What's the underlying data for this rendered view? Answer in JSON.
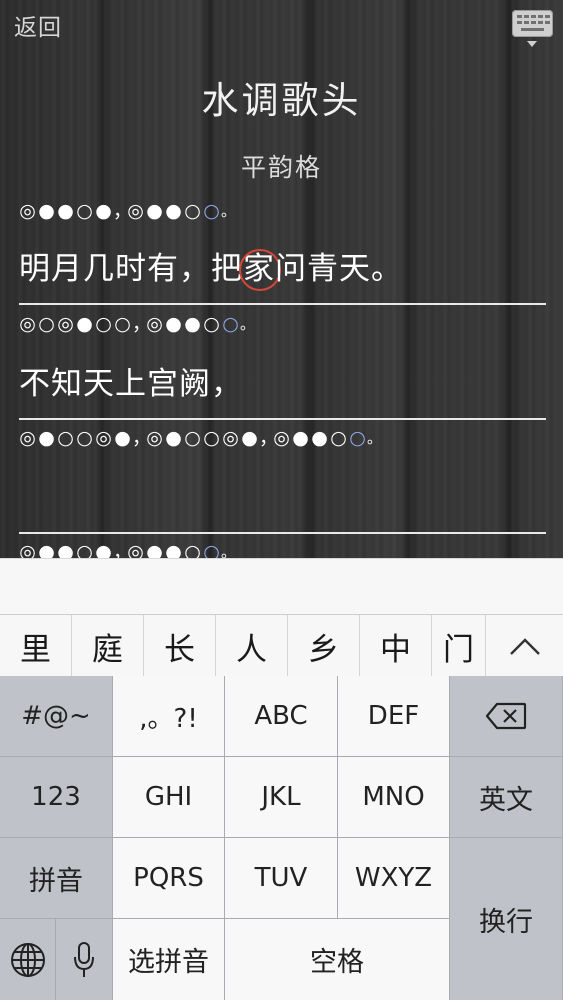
{
  "nav": {
    "back_label": "返回",
    "keyboard_toggle_icon": "keyboard-hide-icon"
  },
  "poem": {
    "title": "水调歌头",
    "subtitle": "平韵格",
    "lines": [
      {
        "pattern": [
          "◎",
          "●",
          "●",
          "○",
          "●",
          "，",
          "◎",
          "●",
          "●",
          "○",
          "○",
          "。"
        ],
        "rhyme_index": 10,
        "text": "明月几时有，把家问青天。",
        "cursor_index": 7
      },
      {
        "pattern": [
          "◎",
          "○",
          "◎",
          "●",
          "○",
          "○",
          "，",
          "◎",
          "●",
          "●",
          "○",
          "○",
          "。"
        ],
        "rhyme_index": 11,
        "text": "不知天上宫阙，",
        "cursor_index": -1
      },
      {
        "pattern": [
          "◎",
          "●",
          "○",
          "○",
          "◎",
          "●",
          "，",
          "◎",
          "●",
          "○",
          "○",
          "◎",
          "●",
          "，",
          "◎",
          "●",
          "●",
          "○",
          "○",
          "。"
        ],
        "rhyme_index": 18,
        "text": "",
        "cursor_index": -1
      },
      {
        "pattern": [
          "◎",
          "●",
          "●",
          "○",
          "●",
          "，",
          "◎",
          "●",
          "●",
          "○",
          "○",
          "。"
        ],
        "rhyme_index": 10,
        "text": "",
        "cursor_index": -1
      }
    ]
  },
  "candidates": {
    "items": [
      "里",
      "庭",
      "长",
      "人",
      "乡",
      "中",
      "门"
    ],
    "expand_icon": "chevron-up-icon"
  },
  "keyboard": {
    "symbols_key": "#@~",
    "punct_key": ",。?!",
    "abc_key": "ABC",
    "def_key": "DEF",
    "delete_icon": "delete-icon",
    "numbers_key": "123",
    "ghi_key": "GHI",
    "jkl_key": "JKL",
    "mno_key": "MNO",
    "english_key": "英文",
    "pinyin_key": "拼音",
    "pqrs_key": "PQRS",
    "tuv_key": "TUV",
    "wxyz_key": "WXYZ",
    "return_key": "换行",
    "globe_icon": "globe-icon",
    "mic_icon": "microphone-icon",
    "select_pinyin_key": "选拼音",
    "space_key": "空格"
  },
  "colors": {
    "rhyme_circle": "#8ea8e6",
    "cursor_ring": "#d6473a"
  }
}
